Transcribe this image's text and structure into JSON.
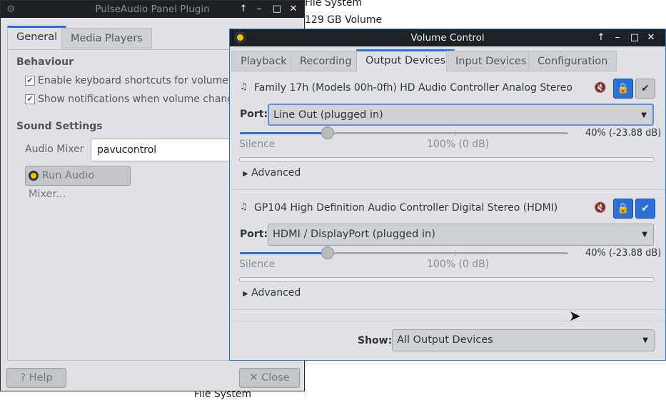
{
  "background": {
    "items": [
      "File System",
      "129 GB Volume",
      "File System"
    ]
  },
  "panel_plugin": {
    "title": "PulseAudio Panel Plugin",
    "tabs": [
      "General",
      "Media Players"
    ],
    "behaviour_heading": "Behaviour",
    "checks": [
      {
        "label": "Enable keyboard shortcuts for volume co",
        "checked": true
      },
      {
        "label": "Show notifications when volume change",
        "checked": true
      }
    ],
    "sound_heading": "Sound Settings",
    "mixer_label": "Audio Mixer",
    "mixer_value": "pavucontrol",
    "run_mixer": "Run Audio Mixer...",
    "help": "Help",
    "close": "Close"
  },
  "volume_control": {
    "title": "Volume Control",
    "tabs": [
      "Playback",
      "Recording",
      "Output Devices",
      "Input Devices",
      "Configuration"
    ],
    "selected_tab": "Output Devices",
    "port_label": "Port:",
    "devices": [
      {
        "name": "Family 17h (Models 00h-0fh) HD Audio Controller Analog Stereo",
        "port": "Line Out (plugged in)",
        "volume_percent": 40,
        "volume_text": "40% (-23.88 dB)",
        "locked": true,
        "default": false,
        "silence": "Silence",
        "hundred": "100% (0 dB)",
        "advanced": "Advanced"
      },
      {
        "name": "GP104 High Definition Audio Controller Digital Stereo (HDMI)",
        "port": "HDMI / DisplayPort (plugged in)",
        "volume_percent": 40,
        "volume_text": "40% (-23.88 dB)",
        "locked": true,
        "default": true,
        "silence": "Silence",
        "hundred": "100% (0 dB)",
        "advanced": "Advanced"
      }
    ],
    "show_label": "Show:",
    "show_value": "All Output Devices",
    "accent": "#2c6fd9"
  }
}
